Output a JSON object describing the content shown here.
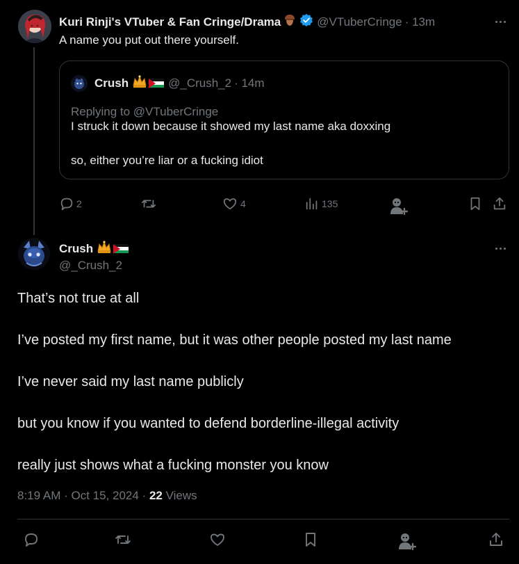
{
  "colors": {
    "background": "#000000",
    "text": "#e7e9ea",
    "muted": "#71767b",
    "border": "#2f3336",
    "verified": "#1d9bf0",
    "crown": "#f5a623"
  },
  "parent_tweet": {
    "author_name": "Kuri Rinji's VTuber & Fan Cringe/Drama",
    "author_emoji": "acorn-emoji",
    "verified": true,
    "handle": "@VTuberCringe",
    "time": "· 13m",
    "text": "A name you put out there yourself.",
    "quote": {
      "author_name": "Crush",
      "badges": [
        "crown-emoji",
        "palestine-flag-emoji"
      ],
      "handle": "@_Crush_2",
      "time": "· 14m",
      "replying_to": "Replying to @VTuberCringe",
      "text_line1": "I struck it down because it showed my last name aka doxxing",
      "text_line2": "so, either you’re liar or a fucking idiot"
    },
    "actions": {
      "reply_count": "2",
      "retweet_count": "",
      "like_count": "4",
      "view_count": "135"
    }
  },
  "main_tweet": {
    "author_name": "Crush",
    "badges": [
      "crown-emoji",
      "palestine-flag-emoji"
    ],
    "handle": "@_Crush_2",
    "paragraphs": [
      "That’s not true at all",
      "I’ve posted my first name, but it was other people posted my last name",
      "I’ve never said my last name publicly",
      "but  you know if you wanted to defend borderline-illegal activity",
      "really just shows what a fucking monster you know"
    ],
    "timestamp": "8:19 AM · Oct 15, 2024",
    "separator": "·",
    "view_count": "22",
    "views_label": "Views"
  }
}
